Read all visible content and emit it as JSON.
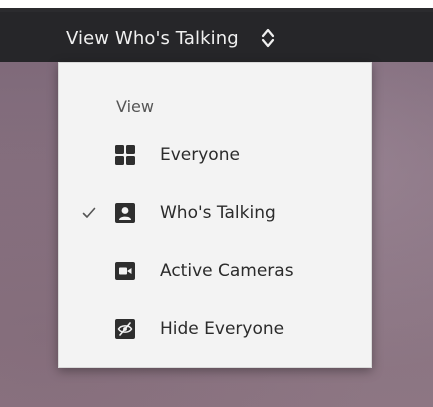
{
  "toolbar": {
    "view_select_label": "View Who's Talking"
  },
  "menu": {
    "header": "View",
    "items": [
      {
        "label": "Everyone",
        "icon": "grid-icon",
        "selected": false
      },
      {
        "label": "Who's Talking",
        "icon": "person-icon",
        "selected": true
      },
      {
        "label": "Active Cameras",
        "icon": "camera-icon",
        "selected": false
      },
      {
        "label": "Hide Everyone",
        "icon": "eye-slash-icon",
        "selected": false
      }
    ]
  },
  "colors": {
    "toolbar_bg": "#262629",
    "menu_bg": "#f3f3f3",
    "icon": "#2e2e2e",
    "text": "#2b2b2b"
  }
}
